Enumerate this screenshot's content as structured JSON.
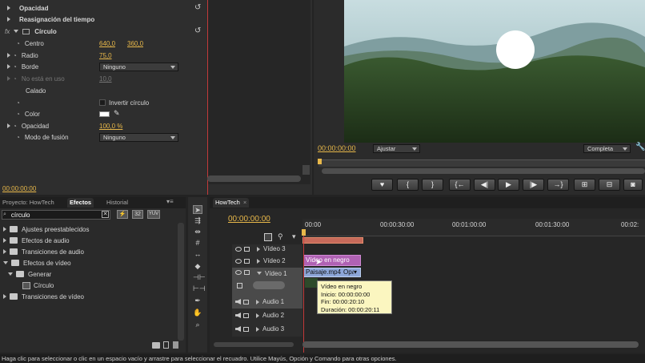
{
  "effect_controls": {
    "opacity": "Opacidad",
    "time_remap": "Reasignación del tiempo",
    "effect_name": "Círculo",
    "center_label": "Centro",
    "center_x": "640,0",
    "center_y": "360,0",
    "radius_label": "Radio",
    "radius_value": "75,0",
    "edge_label": "Borde",
    "edge_value": "Ninguno",
    "unused_label": "No está en uso",
    "unused_value": "10,0",
    "feather_label": "Calado",
    "invert_label": "Invertir círculo",
    "color_label": "Color",
    "opacity2_label": "Opacidad",
    "opacity2_value": "100,0 %",
    "blend_label": "Modo de fusión",
    "blend_value": "Ninguno",
    "timecode": "00:00:00:00"
  },
  "program": {
    "timecode": "00:00:00:00",
    "fit": "Ajustar",
    "quality": "Completa"
  },
  "project": {
    "tabs": [
      "Proyecto: HowTech",
      "Efectos",
      "Historial"
    ],
    "search_value": "círculo",
    "btn_32": "32",
    "btn_yuv": "YUV",
    "tree": [
      "Ajustes preestablecidos",
      "Efectos de audio",
      "Transiciones de audio",
      "Efectos de vídeo",
      "Generar",
      "Círculo",
      "Transiciones de vídeo"
    ]
  },
  "timeline": {
    "tab": "HowTech",
    "timecode": "00:00:00:00",
    "ruler": [
      "00:00",
      "00:00:30:00",
      "00:01:00:00",
      "00:01:30:00",
      "00:02:"
    ],
    "tracks": [
      "Vídeo 3",
      "Vídeo 2",
      "Vídeo 1",
      "Audio 1",
      "Audio 2",
      "Audio 3"
    ],
    "clip_black": "Vídeo en negro",
    "clip_landscape": "Paisaje.mp4",
    "clip_suffix": "Opacidad",
    "tooltip": {
      "title": "Vídeo en negro",
      "start": "Inicio: 00:00:00:00",
      "end": "Fin: 00:00:20:10",
      "duration": "Duración: 00:00:20:11"
    }
  },
  "status_bar": "Haga clic para seleccionar o clic en un espacio vacío y arrastre para seleccionar el recuadro. Utilice Mayús, Opción y Comando para otras opciones."
}
